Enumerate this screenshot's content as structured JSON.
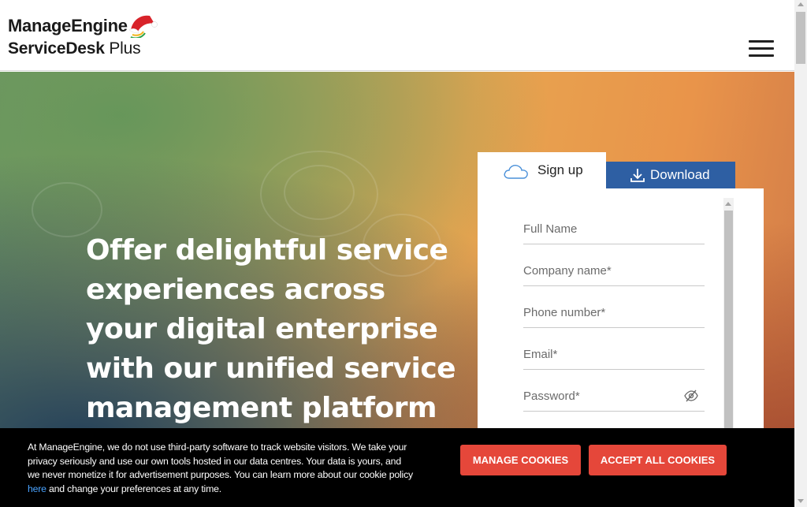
{
  "header": {
    "logo_line1_bold": "ManageEngine",
    "logo_line2_bold": "ServiceDesk",
    "logo_line2_rest": " Plus",
    "menu_icon": "hamburger-menu-icon"
  },
  "hero": {
    "title": "Offer delightful service experiences across your digital enterprise with our unified service management platform"
  },
  "form": {
    "tabs": {
      "signup_label": "Sign up",
      "signup_icon": "cloud-icon",
      "download_label": "Download",
      "download_icon": "download-icon"
    },
    "fields": {
      "full_name_placeholder": "Full Name",
      "company_placeholder": "Company name*",
      "phone_placeholder": "Phone number*",
      "email_placeholder": "Email*",
      "password_placeholder": "Password*"
    },
    "password_toggle_icon": "eye-slash-icon"
  },
  "cookie_banner": {
    "text_before_link": "At ManageEngine, we do not use third-party software to track website visitors. We take your privacy seriously and use our own tools hosted in our data centres. Your data is yours, and we never monetize it for advertisement purposes. You can learn more about our cookie policy ",
    "link_text": "here",
    "text_after_link": " and change your preferences at any time.",
    "manage_button": "MANAGE COOKIES",
    "accept_button": "ACCEPT ALL COOKIES"
  },
  "colors": {
    "download_tab": "#2e5fa3",
    "cookie_button": "#e5473a",
    "cookie_link": "#4aa3ff",
    "banner_bg": "#000000"
  }
}
